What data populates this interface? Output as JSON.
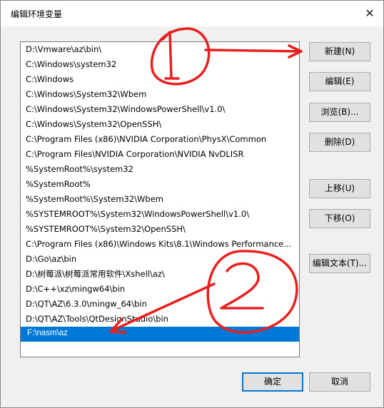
{
  "window": {
    "title": "编辑环境变量",
    "close_glyph": "✕"
  },
  "paths": [
    "D:\\Vmware\\az\\bin\\",
    "C:\\Windows\\system32",
    "C:\\Windows",
    "C:\\Windows\\System32\\Wbem",
    "C:\\Windows\\System32\\WindowsPowerShell\\v1.0\\",
    "C:\\Windows\\System32\\OpenSSH\\",
    "C:\\Program Files (x86)\\NVIDIA Corporation\\PhysX\\Common",
    "C:\\Program Files\\NVIDIA Corporation\\NVIDIA NvDLISR",
    "%SystemRoot%\\system32",
    "%SystemRoot%",
    "%SystemRoot%\\System32\\Wbem",
    "%SYSTEMROOT%\\System32\\WindowsPowerShell\\v1.0\\",
    "%SYSTEMROOT%\\System32\\OpenSSH\\",
    "C:\\Program Files (x86)\\Windows Kits\\8.1\\Windows Performance...",
    "D:\\Go\\az\\bin",
    "D:\\树莓派\\树莓派常用软件\\Xshell\\az\\",
    "D:\\C++\\xz\\mingw64\\bin",
    "D:\\QT\\AZ\\6.3.0\\mingw_64\\bin",
    "D:\\QT\\AZ\\Tools\\QtDesignStudio\\bin"
  ],
  "editing": {
    "value": "F:\\nasm\\az"
  },
  "buttons": {
    "new": "新建(N)",
    "edit": "编辑(E)",
    "browse": "浏览(B)...",
    "delete": "删除(D)",
    "move_up": "上移(U)",
    "move_down": "下移(O)",
    "edit_text": "编辑文本(T)...",
    "ok": "确定",
    "cancel": "取消"
  },
  "annotations": {
    "mark1": "①",
    "mark2": "②",
    "color": "#e82020"
  },
  "colors": {
    "selection": "#0078d7",
    "button": "#e1e1e1"
  }
}
